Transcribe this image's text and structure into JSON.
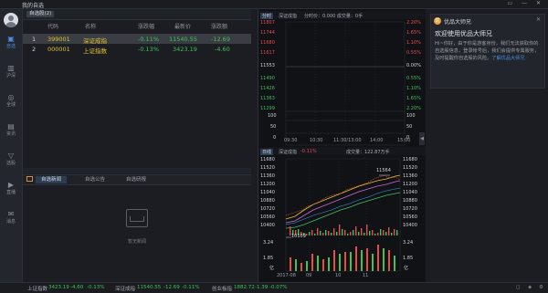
{
  "window": {
    "title": "我的自选",
    "controls": "▭ — ✕"
  },
  "sidebar": {
    "items": [
      {
        "label": "自选",
        "icon": "star-grid-icon"
      },
      {
        "label": "沪深",
        "icon": "chart-icon"
      },
      {
        "label": "全球",
        "icon": "globe-icon"
      },
      {
        "label": "资讯",
        "icon": "news-icon"
      },
      {
        "label": "选股",
        "icon": "filter-icon"
      },
      {
        "label": "直播",
        "icon": "live-icon"
      },
      {
        "label": "消息",
        "icon": "message-icon"
      }
    ]
  },
  "watchlist": {
    "group": "自选股(2)",
    "columns": [
      "代码",
      "名称",
      "涨跌幅",
      "最新价",
      "涨跌额"
    ],
    "rows": [
      {
        "idx": "1",
        "code": "399001",
        "name": "深证成指",
        "pct": "-0.11%",
        "price": "11540.55",
        "chg": "-12.69"
      },
      {
        "idx": "2",
        "code": "000001",
        "name": "上证指数",
        "pct": "-0.13%",
        "price": "3423.19",
        "chg": "-4.60"
      }
    ]
  },
  "bottom": {
    "tabs": [
      "自选新闻",
      "自选公告",
      "自选研报"
    ],
    "empty_text": "暂无新闻"
  },
  "chart_panel": {
    "intraday": {
      "tab": "分时",
      "name": "深证成指",
      "info": "分时价：0.000   成交量：0手",
      "right_axis": [
        "2.20%",
        "1.65%",
        "1.10%",
        "0.55%",
        "0.00%",
        "0.55%",
        "1.10%",
        "1.65%",
        "2.20%"
      ],
      "left_axis": [
        "11807",
        "11744",
        "11680",
        "11617",
        "11553",
        "11490",
        "11426",
        "11363",
        "11299"
      ],
      "vol_axis": [
        "100",
        "50",
        "0"
      ],
      "time_axis": [
        "09:30",
        "10:30",
        "11:30/13:00",
        "14:00",
        "15:00"
      ],
      "vol_labels": [
        "100",
        "50",
        "0"
      ]
    },
    "daily": {
      "tab": "日线",
      "name": "深证成指",
      "pct": "-0.11%",
      "vol": "成交量：122.87万手",
      "left_axis": [
        "11680",
        "11520",
        "11360",
        "11200",
        "11040",
        "10880",
        "10720",
        "10560",
        "10400"
      ],
      "right_axis": [
        "11680",
        "11520",
        "11360",
        "11200",
        "11040",
        "10880",
        "10720",
        "10560",
        "10400"
      ],
      "high_label": "11564",
      "low_label": "10109",
      "vol_axis": [
        "3.24",
        "1.85",
        "亿"
      ],
      "date_axis": [
        "2017-08",
        "09",
        "10",
        "11"
      ]
    },
    "collapse_icon": "◀"
  },
  "assistant": {
    "logo": "优",
    "name": "优品大师兄",
    "title": "欢迎使用优品大师兄",
    "message": "Hi~你好，由于你是游客身份，我们无法获取你的自选股信息，登录帐号后，我们会提供专属服务，及时提醒你自选股的风险。",
    "link": "了解优品大师兄"
  },
  "status": {
    "items": [
      {
        "name": "上证指数",
        "price": "3423.19",
        "chg": "-4.60",
        "pct": "-0.13%"
      },
      {
        "name": "深证成指",
        "price": "11540.55",
        "chg": "-12.69",
        "pct": "-0.11%"
      },
      {
        "name": "创业板指",
        "price": "1882.72",
        "chg": "-1.39",
        "pct": "-0.07%"
      }
    ]
  },
  "colors": {
    "up": "#e94b4b",
    "down": "#3ec15a",
    "accent": "#4a90e2",
    "line_yellow": "#e3c32a",
    "line_purple": "#c56bd1",
    "line_green": "#3ec15a"
  }
}
